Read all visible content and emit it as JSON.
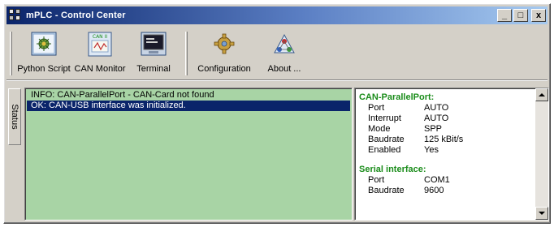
{
  "window": {
    "title": "mPLC - Control Center",
    "minimize_glyph": "_",
    "maximize_glyph": "□",
    "close_glyph": "x"
  },
  "toolbar": {
    "items": [
      {
        "label": "Python Script",
        "icon": "python-script-icon"
      },
      {
        "label": "CAN Monitor",
        "icon": "can-monitor-icon",
        "icon_text": "CAN II"
      },
      {
        "label": "Terminal",
        "icon": "terminal-icon"
      },
      {
        "label": "Configuration",
        "icon": "configuration-icon"
      },
      {
        "label": "About ...",
        "icon": "about-icon"
      }
    ]
  },
  "status_tab": {
    "label": "Status"
  },
  "log": {
    "lines": [
      {
        "text": "INFO: CAN-ParallelPort - CAN-Card not found",
        "selected": false
      },
      {
        "text": "OK: CAN-USB interface was initialized.",
        "selected": true
      }
    ]
  },
  "properties": {
    "sections": [
      {
        "title": "CAN-ParallelPort:",
        "rows": [
          {
            "key": "Port",
            "value": "AUTO"
          },
          {
            "key": "Interrupt",
            "value": "AUTO"
          },
          {
            "key": "Mode",
            "value": "SPP"
          },
          {
            "key": "Baudrate",
            "value": "125 kBit/s"
          },
          {
            "key": "Enabled",
            "value": "Yes"
          }
        ]
      },
      {
        "title": "Serial interface:",
        "rows": [
          {
            "key": "Port",
            "value": "COM1"
          },
          {
            "key": "Baudrate",
            "value": "9600"
          }
        ]
      }
    ]
  },
  "colors": {
    "titlebar_start": "#0a246a",
    "log_background": "#a8d4a5",
    "selection": "#0a246a",
    "section_title": "#1a8c1a"
  }
}
